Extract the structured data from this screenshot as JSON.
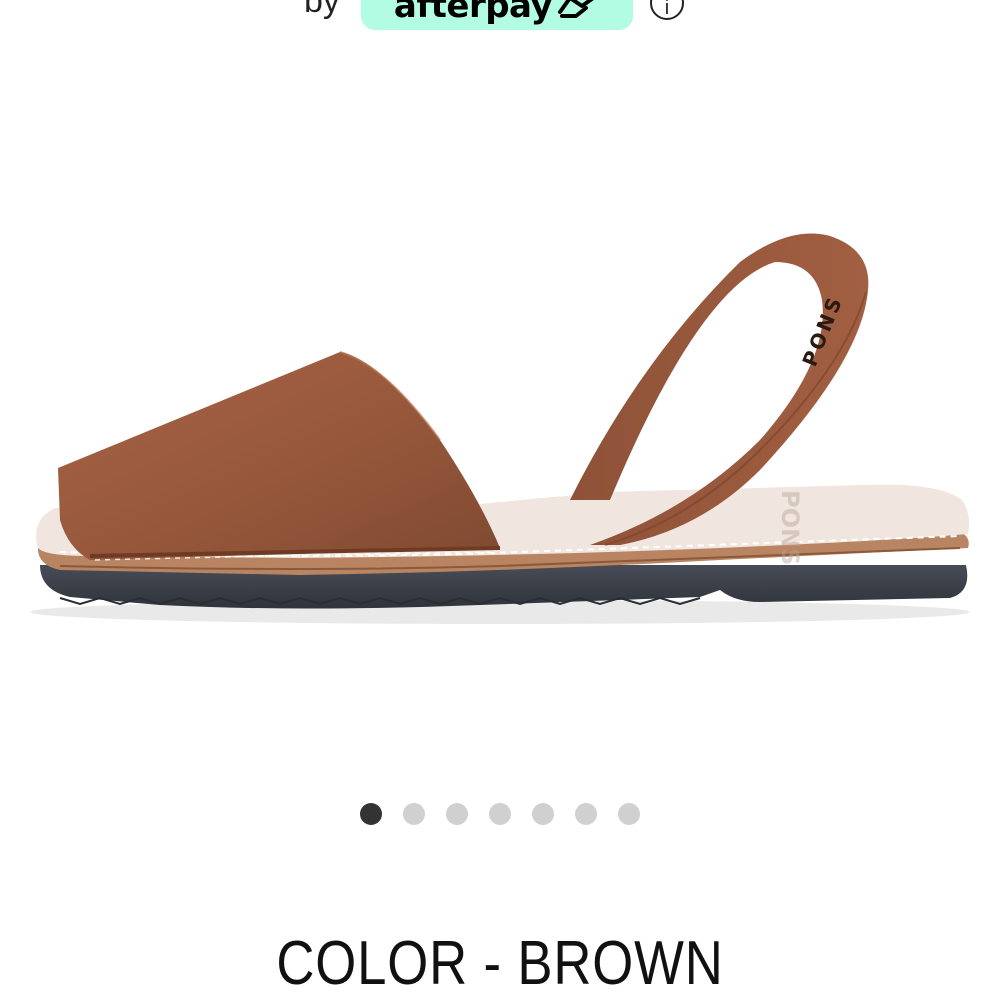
{
  "payment": {
    "by_label": "by",
    "brand_label": "afterpay",
    "info_label": "i",
    "brand_color": "#b2fce4"
  },
  "product": {
    "image_icon": "sandal-product-image",
    "strap_logo_text": "PONS",
    "insole_logo_text": "PONS",
    "upper_color": "#9c5a3c",
    "sole_color": "#3a3f48"
  },
  "carousel": {
    "total": 7,
    "active_index": 0
  },
  "color_selector": {
    "label": "COLOR - BROWN"
  }
}
